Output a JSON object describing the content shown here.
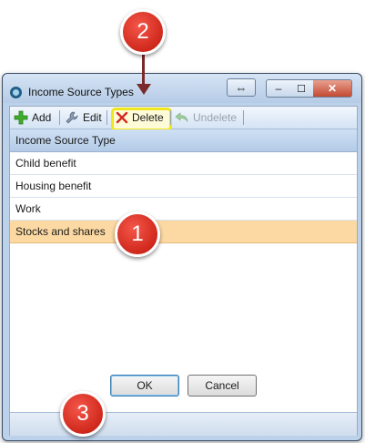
{
  "window": {
    "title": "Income Source Types",
    "restore_glyph": "⇔",
    "min_glyph": "–",
    "max_glyph": "☐",
    "close_glyph": "✕"
  },
  "toolbar": {
    "add_label": "Add",
    "edit_label": "Edit",
    "delete_label": "Delete",
    "undelete_label": "Undelete"
  },
  "list": {
    "column_header": "Income Source Type",
    "rows": [
      "Child benefit",
      "Housing benefit",
      "Work",
      "Stocks and shares"
    ],
    "selected_index": 3
  },
  "footer": {
    "ok_label": "OK",
    "cancel_label": "Cancel"
  },
  "annotations": {
    "callout_1": "1",
    "callout_2": "2",
    "callout_3": "3"
  },
  "colors": {
    "selected_row": "#fcd9a2",
    "delete_highlight": "#f0e61d",
    "callout_red": "#d0281c"
  }
}
